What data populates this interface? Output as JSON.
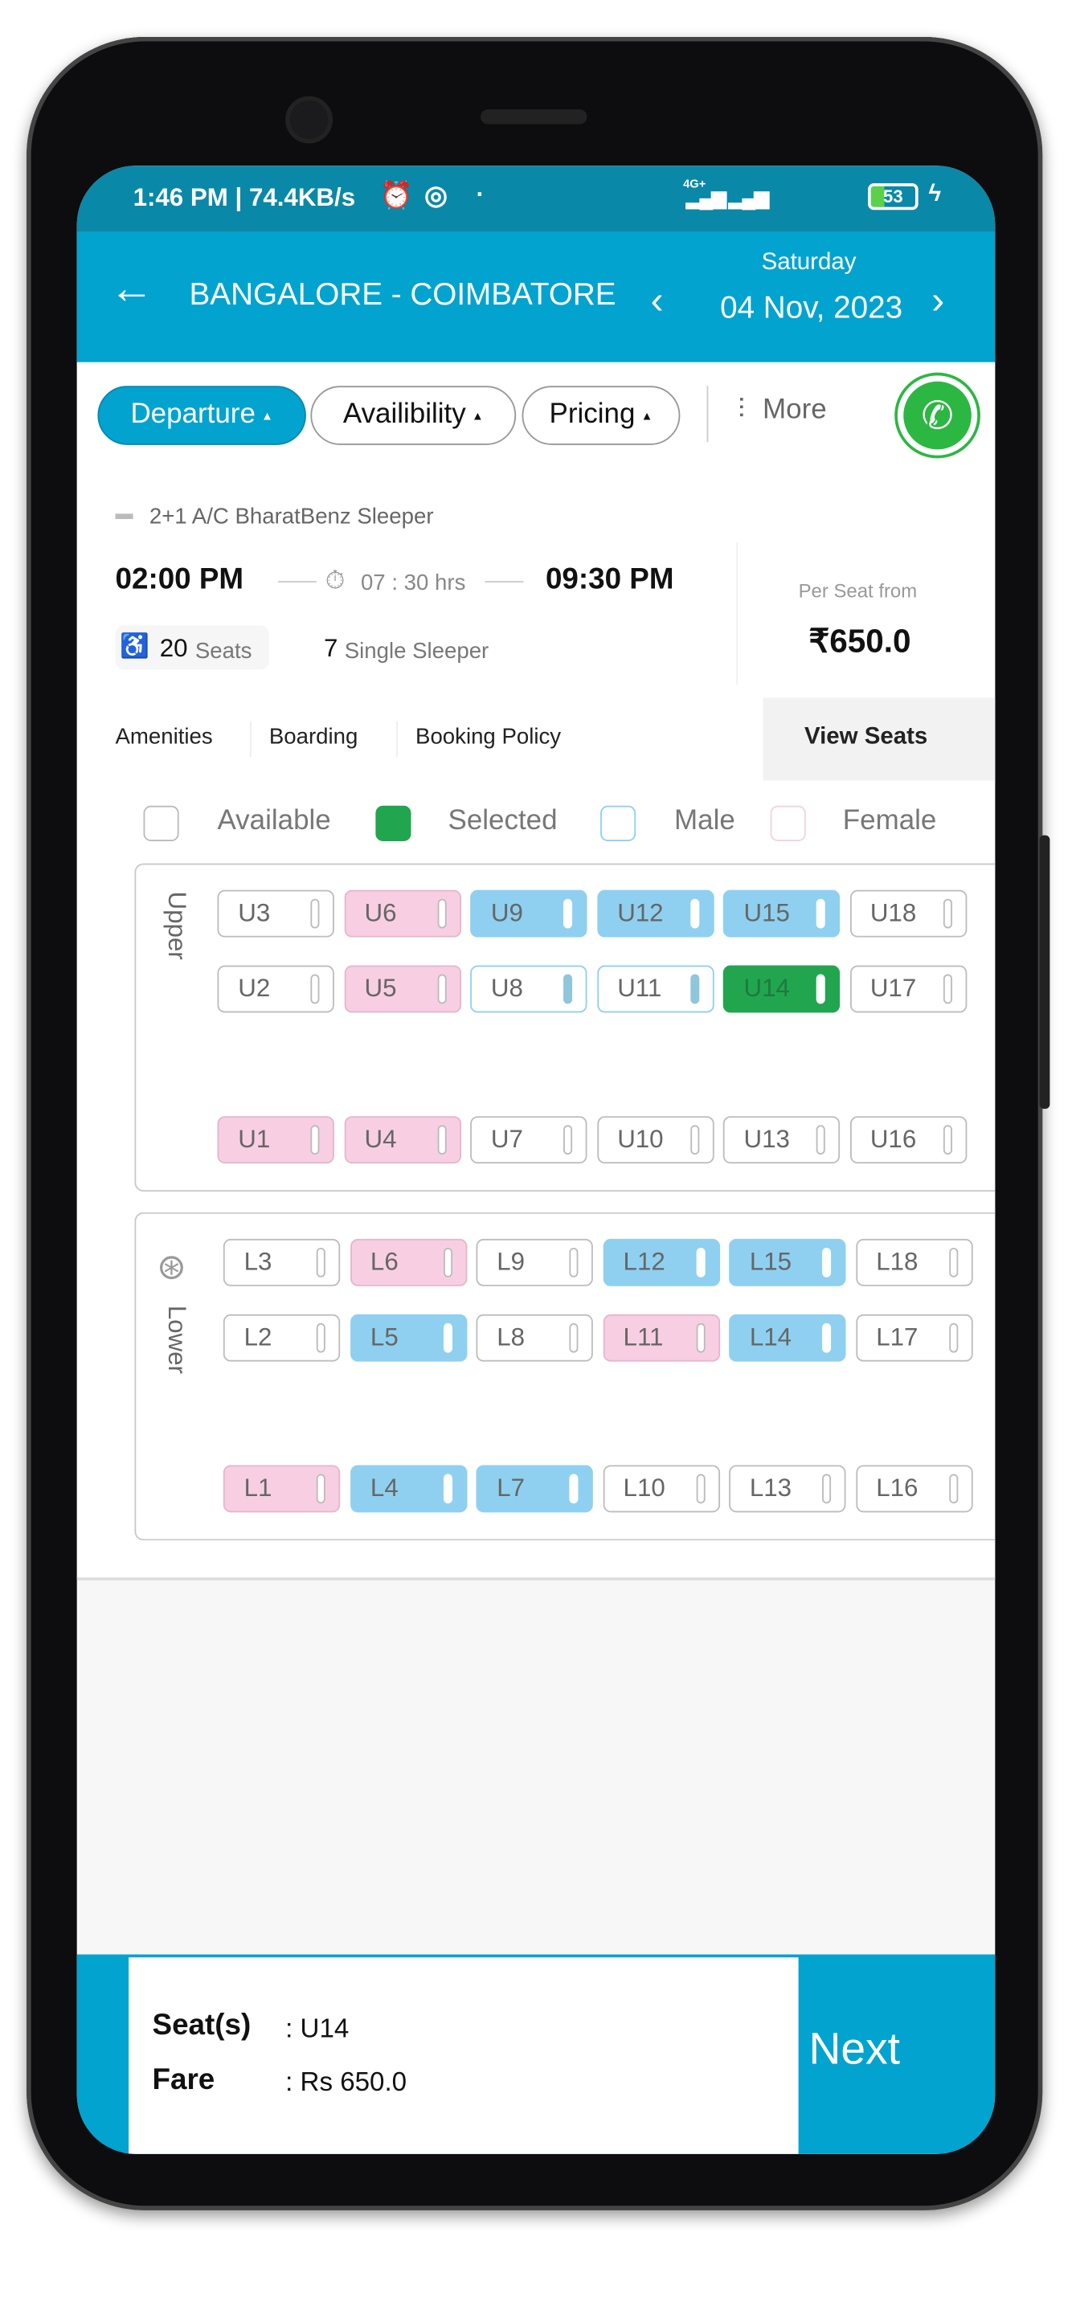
{
  "status_bar": {
    "time": "1:46 PM | 74.4KB/s",
    "battery": "53",
    "network": "4G+"
  },
  "header": {
    "route": "BANGALORE - COIMBATORE",
    "day": "Saturday",
    "date": "04 Nov, 2023"
  },
  "filters": {
    "departure": "Departure",
    "availability": "Availibility",
    "pricing": "Pricing",
    "more": "More"
  },
  "bus": {
    "type": "2+1 A/C BharatBenz Sleeper",
    "departure": "02:00 PM",
    "duration": "07 : 30 hrs",
    "arrival": "09:30 PM",
    "seats_count": "20",
    "seats_label": "Seats",
    "single_count": "7",
    "single_label": "Single Sleeper",
    "price_label": "Per Seat from",
    "price": "₹650.0"
  },
  "tabs": {
    "amenities": "Amenities",
    "boarding": "Boarding",
    "policy": "Booking Policy",
    "view_seats": "View Seats"
  },
  "legend": {
    "available": "Available",
    "selected": "Selected",
    "male": "Male",
    "female": "Female"
  },
  "colors": {
    "brand": "#02a3cf",
    "selected": "#22a54f",
    "male": "#8fd0f0",
    "female": "#f8cfe2"
  },
  "decks": [
    {
      "label": "Upper",
      "rows": [
        [
          [
            "U3",
            "available"
          ],
          [
            "U6",
            "female"
          ],
          [
            "U9",
            "male"
          ],
          [
            "U12",
            "male"
          ],
          [
            "U15",
            "male"
          ],
          [
            "U18",
            "available"
          ]
        ],
        [
          [
            "U2",
            "available"
          ],
          [
            "U5",
            "female"
          ],
          [
            "U8",
            "male-avail"
          ],
          [
            "U11",
            "male-avail"
          ],
          [
            "U14",
            "selected"
          ],
          [
            "U17",
            "available"
          ]
        ],
        [
          [
            "U1",
            "female"
          ],
          [
            "U4",
            "female"
          ],
          [
            "U7",
            "available"
          ],
          [
            "U10",
            "available"
          ],
          [
            "U13",
            "available"
          ],
          [
            "U16",
            "available"
          ]
        ]
      ]
    },
    {
      "label": "Lower",
      "rows": [
        [
          [
            "L3",
            "available"
          ],
          [
            "L6",
            "female"
          ],
          [
            "L9",
            "available"
          ],
          [
            "L12",
            "male"
          ],
          [
            "L15",
            "male"
          ],
          [
            "L18",
            "available"
          ]
        ],
        [
          [
            "L2",
            "available"
          ],
          [
            "L5",
            "male"
          ],
          [
            "L8",
            "available"
          ],
          [
            "L11",
            "female"
          ],
          [
            "L14",
            "male"
          ],
          [
            "L17",
            "available"
          ]
        ],
        [
          [
            "L1",
            "female"
          ],
          [
            "L4",
            "male"
          ],
          [
            "L7",
            "male"
          ],
          [
            "L10",
            "available"
          ],
          [
            "L13",
            "available"
          ],
          [
            "L16",
            "available"
          ]
        ]
      ]
    }
  ],
  "summary": {
    "seats_label": "Seat(s)",
    "seats_value": ": U14",
    "fare_label": "Fare",
    "fare_value": ": Rs 650.0",
    "next": "Next"
  }
}
